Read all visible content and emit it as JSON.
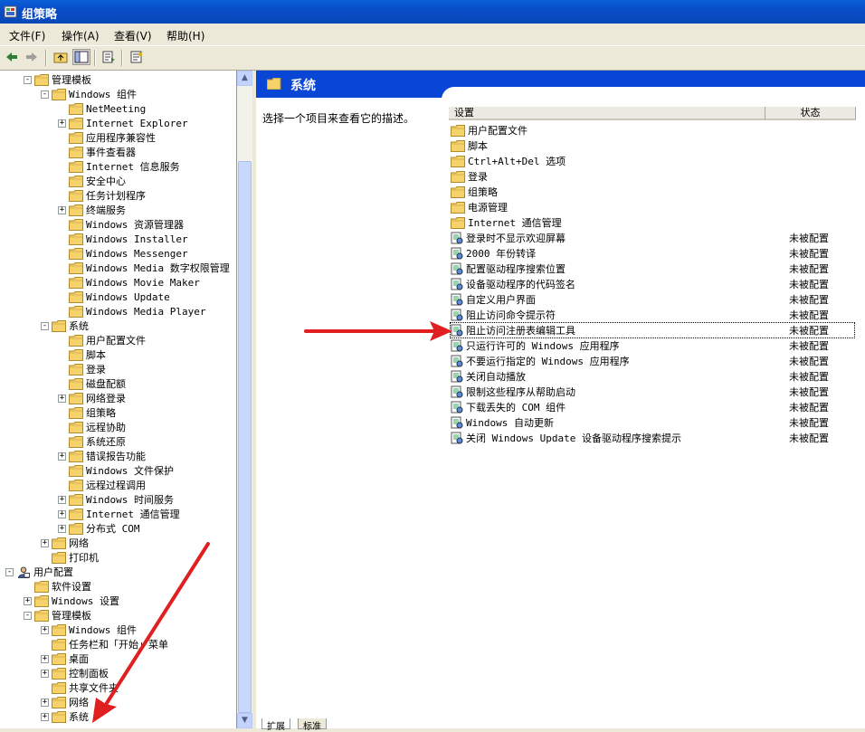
{
  "window": {
    "title": "组策略",
    "icon": "group-policy-icon"
  },
  "menu": [
    "文件(F)",
    "操作(A)",
    "查看(V)",
    "帮助(H)"
  ],
  "toolbar": [
    "back-arrow-icon",
    "forward-arrow-icon",
    "up-folder-icon",
    "show-hide-tree-icon",
    "export-list-icon",
    "properties-icon"
  ],
  "tree": [
    {
      "label": "管理模板",
      "level": 1,
      "exp": "-"
    },
    {
      "label": "Windows 组件",
      "level": 2,
      "exp": "-"
    },
    {
      "label": "NetMeeting",
      "level": 3,
      "exp": ""
    },
    {
      "label": "Internet Explorer",
      "level": 3,
      "exp": "+"
    },
    {
      "label": "应用程序兼容性",
      "level": 3,
      "exp": ""
    },
    {
      "label": "事件查看器",
      "level": 3,
      "exp": ""
    },
    {
      "label": "Internet 信息服务",
      "level": 3,
      "exp": ""
    },
    {
      "label": "安全中心",
      "level": 3,
      "exp": ""
    },
    {
      "label": "任务计划程序",
      "level": 3,
      "exp": ""
    },
    {
      "label": "终端服务",
      "level": 3,
      "exp": "+"
    },
    {
      "label": "Windows 资源管理器",
      "level": 3,
      "exp": ""
    },
    {
      "label": "Windows Installer",
      "level": 3,
      "exp": ""
    },
    {
      "label": "Windows Messenger",
      "level": 3,
      "exp": ""
    },
    {
      "label": "Windows Media 数字权限管理",
      "level": 3,
      "exp": ""
    },
    {
      "label": "Windows Movie Maker",
      "level": 3,
      "exp": ""
    },
    {
      "label": "Windows Update",
      "level": 3,
      "exp": ""
    },
    {
      "label": "Windows Media Player",
      "level": 3,
      "exp": ""
    },
    {
      "label": "系统",
      "level": 2,
      "exp": "-"
    },
    {
      "label": "用户配置文件",
      "level": 3,
      "exp": ""
    },
    {
      "label": "脚本",
      "level": 3,
      "exp": ""
    },
    {
      "label": "登录",
      "level": 3,
      "exp": ""
    },
    {
      "label": "磁盘配额",
      "level": 3,
      "exp": ""
    },
    {
      "label": "网络登录",
      "level": 3,
      "exp": "+"
    },
    {
      "label": "组策略",
      "level": 3,
      "exp": ""
    },
    {
      "label": "远程协助",
      "level": 3,
      "exp": ""
    },
    {
      "label": "系统还原",
      "level": 3,
      "exp": ""
    },
    {
      "label": "错误报告功能",
      "level": 3,
      "exp": "+"
    },
    {
      "label": "Windows 文件保护",
      "level": 3,
      "exp": ""
    },
    {
      "label": "远程过程调用",
      "level": 3,
      "exp": ""
    },
    {
      "label": "Windows 时间服务",
      "level": 3,
      "exp": "+"
    },
    {
      "label": "Internet 通信管理",
      "level": 3,
      "exp": "+"
    },
    {
      "label": "分布式 COM",
      "level": 3,
      "exp": "+"
    },
    {
      "label": "网络",
      "level": 2,
      "exp": "+"
    },
    {
      "label": "打印机",
      "level": 2,
      "exp": ""
    },
    {
      "label": "用户配置",
      "level": 0,
      "exp": "-",
      "icon": "user-config-icon"
    },
    {
      "label": "软件设置",
      "level": 1,
      "exp": ""
    },
    {
      "label": "Windows 设置",
      "level": 1,
      "exp": "+"
    },
    {
      "label": "管理模板",
      "level": 1,
      "exp": "-"
    },
    {
      "label": "Windows 组件",
      "level": 2,
      "exp": "+"
    },
    {
      "label": "任务栏和「开始」菜单",
      "level": 2,
      "exp": ""
    },
    {
      "label": "桌面",
      "level": 2,
      "exp": "+"
    },
    {
      "label": "控制面板",
      "level": 2,
      "exp": "+"
    },
    {
      "label": "共享文件夹",
      "level": 2,
      "exp": ""
    },
    {
      "label": "网络",
      "level": 2,
      "exp": "+"
    },
    {
      "label": "系统",
      "level": 2,
      "exp": "+"
    }
  ],
  "right": {
    "header": "系统",
    "description": "选择一个项目来查看它的描述。",
    "columns": [
      "设置",
      "状态"
    ],
    "folders": [
      "用户配置文件",
      "脚本",
      "Ctrl+Alt+Del 选项",
      "登录",
      "组策略",
      "电源管理",
      "Internet 通信管理"
    ],
    "policies": [
      {
        "name": "登录时不显示欢迎屏幕",
        "state": "未被配置"
      },
      {
        "name": "2000 年份转译",
        "state": "未被配置"
      },
      {
        "name": "配置驱动程序搜索位置",
        "state": "未被配置"
      },
      {
        "name": "设备驱动程序的代码签名",
        "state": "未被配置"
      },
      {
        "name": "自定义用户界面",
        "state": "未被配置"
      },
      {
        "name": "阻止访问命令提示符",
        "state": "未被配置"
      },
      {
        "name": "阻止访问注册表编辑工具",
        "state": "未被配置",
        "selected": true
      },
      {
        "name": "只运行许可的 Windows 应用程序",
        "state": "未被配置"
      },
      {
        "name": "不要运行指定的 Windows 应用程序",
        "state": "未被配置"
      },
      {
        "name": "关闭自动播放",
        "state": "未被配置"
      },
      {
        "name": "限制这些程序从帮助启动",
        "state": "未被配置"
      },
      {
        "name": "下载丢失的 COM 组件",
        "state": "未被配置"
      },
      {
        "name": "Windows 自动更新",
        "state": "未被配置"
      },
      {
        "name": "关闭 Windows Update 设备驱动程序搜索提示",
        "state": "未被配置"
      }
    ]
  },
  "tabs": [
    "扩展",
    "标准"
  ],
  "colors": {
    "accent": "#0A46D6",
    "arrow": "#E02020",
    "folder": "#F5D26A"
  }
}
